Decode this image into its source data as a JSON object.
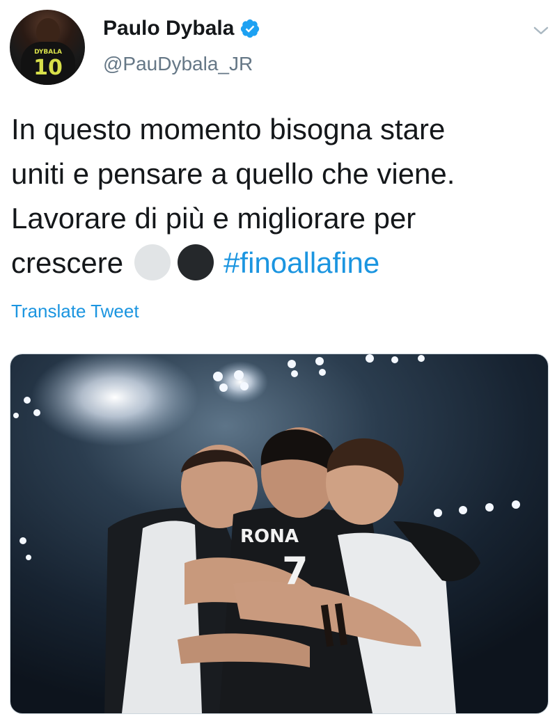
{
  "user": {
    "display_name": "Paulo Dybala",
    "handle": "@PauDybala_JR",
    "avatar_jersey_name": "DYBALA",
    "avatar_jersey_number": "10"
  },
  "tweet": {
    "lines": [
      "In questo momento bisogna stare",
      "uniti e pensare a quello che viene.",
      "Lavorare di più e migliorare per",
      "crescere"
    ],
    "hashtag": "#finoallafine",
    "translate_label": "Translate Tweet"
  },
  "photo": {
    "jersey_name": "RONA",
    "jersey_number": "7"
  },
  "colors": {
    "link": "#1b95e0",
    "text": "#14171a",
    "secondary": "#657786",
    "verified": "#1da1f2"
  },
  "icons": {
    "verified": "verified-badge-icon",
    "caret": "chevron-down-icon"
  }
}
